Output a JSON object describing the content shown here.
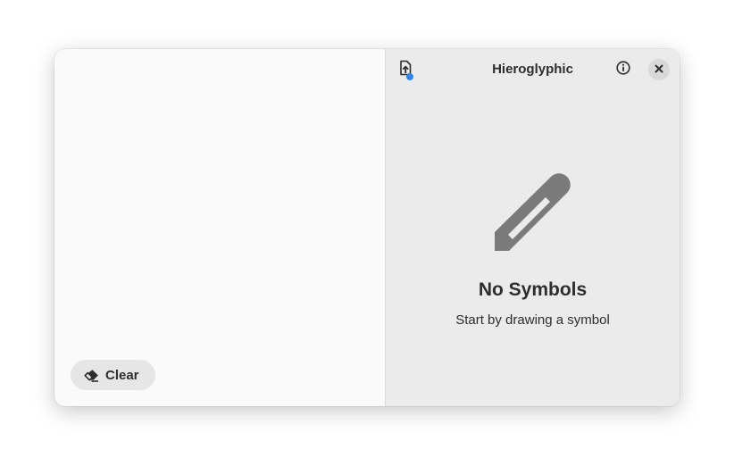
{
  "app": {
    "title": "Hieroglyphic"
  },
  "canvas": {
    "clear_label": "Clear"
  },
  "header": {
    "upload_icon": "document-send-icon",
    "about_icon": "info-icon",
    "close_icon": "close-icon",
    "accent_dot_color": "#3584e4"
  },
  "empty_state": {
    "icon": "pencil-icon",
    "title": "No Symbols",
    "subtitle": "Start by drawing a symbol"
  }
}
